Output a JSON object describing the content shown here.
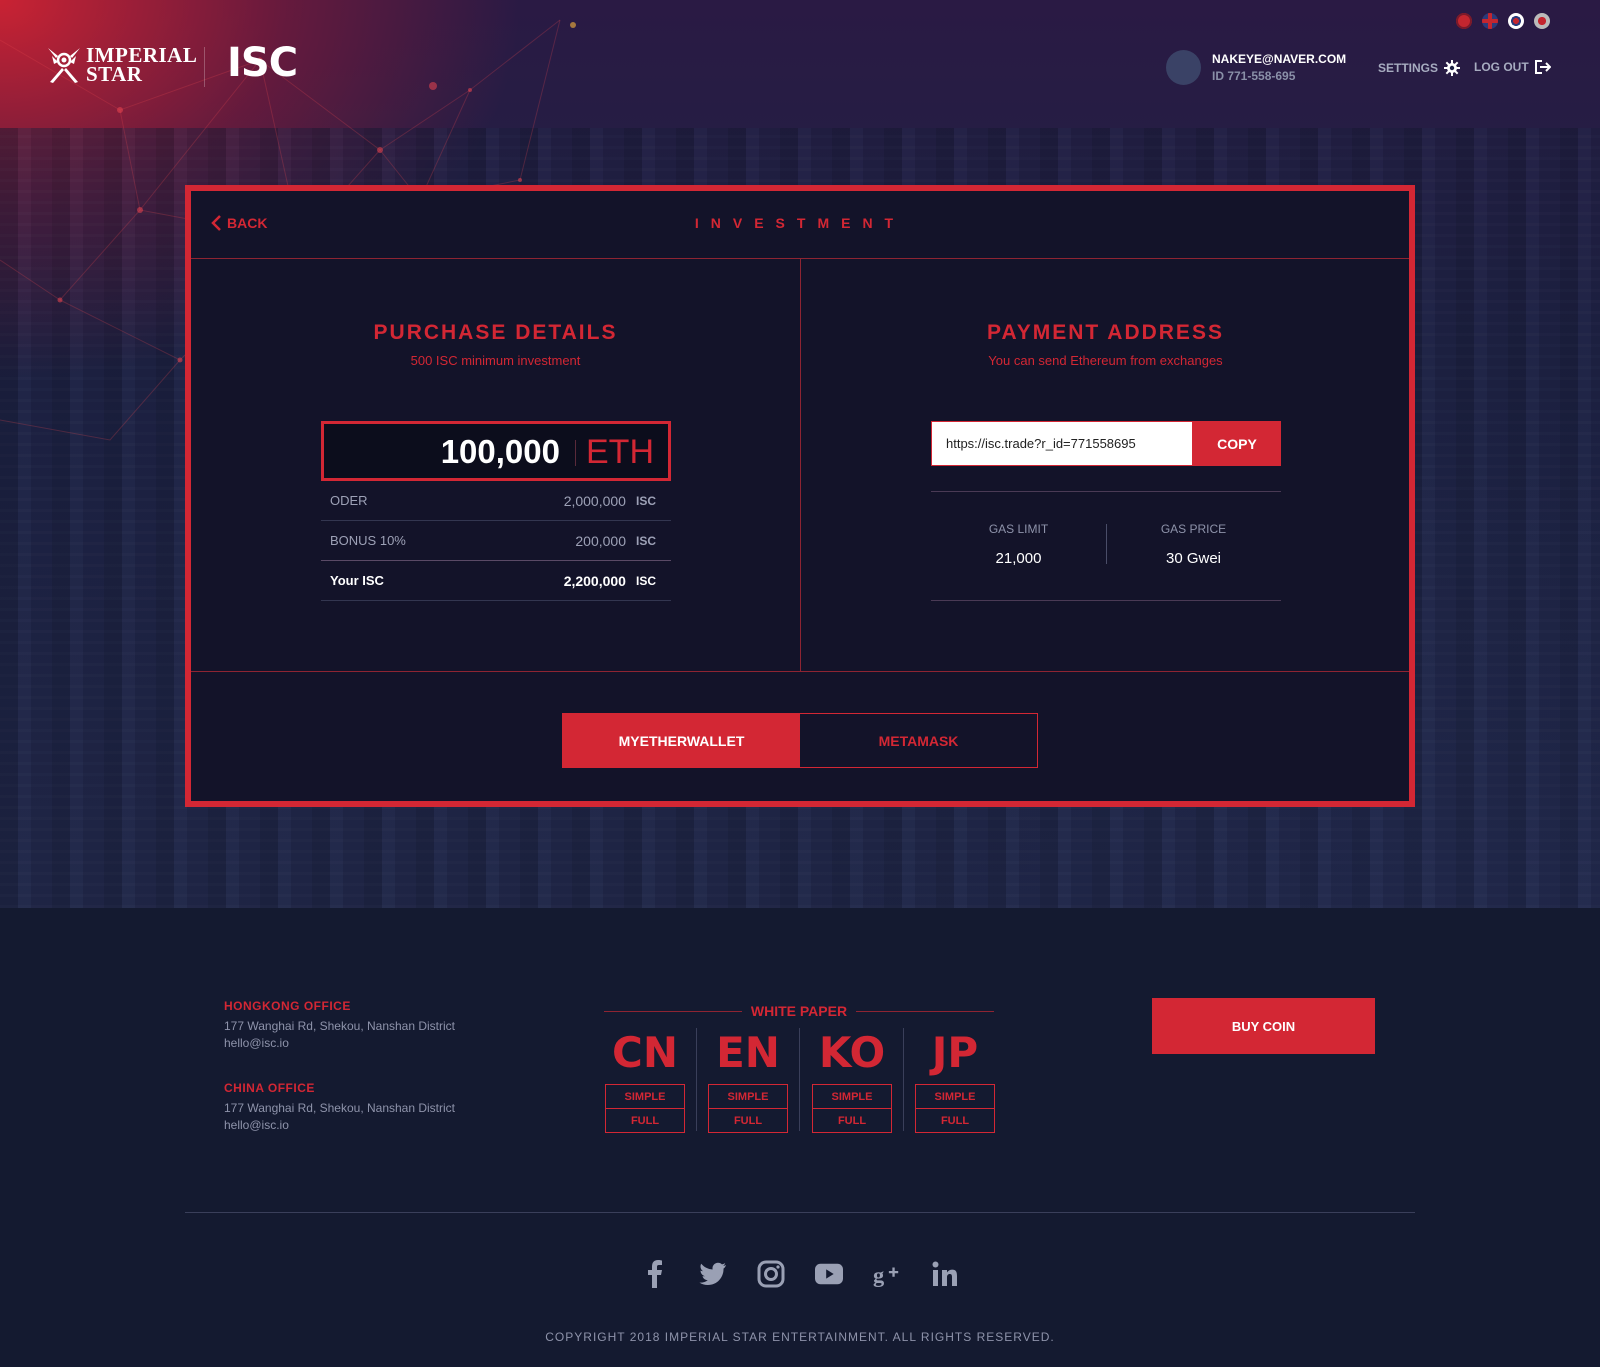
{
  "header": {
    "logo_line1": "IMPERIAL",
    "logo_line2": "STAR",
    "brand": "ISC",
    "user_email": "NAKEYE@NAVER.COM",
    "user_id": "ID 771-558-695",
    "settings_label": "SETTINGS",
    "logout_label": "LOG OUT",
    "flags": [
      "cn-flag",
      "uk-flag",
      "kr-flag",
      "jp-flag"
    ]
  },
  "card": {
    "back_label": "BACK",
    "title": "INVESTMENT",
    "purchase": {
      "title": "PURCHASE DETAILS",
      "subtitle": "500 ISC minimum investment",
      "amount": "100,000",
      "amount_unit": "ETH",
      "rows": [
        {
          "label": "ODER",
          "value": "2,000,000",
          "unit": "ISC"
        },
        {
          "label": "BONUS 10%",
          "value": "200,000",
          "unit": "ISC"
        },
        {
          "label": "Your ISC",
          "value": "2,200,000",
          "unit": "ISC"
        }
      ]
    },
    "payment": {
      "title": "PAYMENT ADDRESS",
      "subtitle": "You can send Ethereum from exchanges",
      "address": "https://isc.trade?r_id=771558695",
      "copy_label": "COPY",
      "gas_limit_label": "GAS LIMIT",
      "gas_limit_value": "21,000",
      "gas_price_label": "GAS PRICE",
      "gas_price_value": "30 Gwei"
    },
    "wallets": [
      "MYETHERWALLET",
      "METAMASK"
    ]
  },
  "footer": {
    "offices": [
      {
        "name": "HONGKONG OFFICE",
        "address": "177 Wanghai Rd, Shekou, Nanshan District",
        "email": "hello@isc.io"
      },
      {
        "name": "CHINA OFFICE",
        "address": "177 Wanghai Rd, Shekou, Nanshan District",
        "email": "hello@isc.io"
      }
    ],
    "white_paper_title": "WHITE PAPER",
    "white_paper": [
      {
        "code": "CN",
        "simple": "SIMPLE",
        "full": "FULL"
      },
      {
        "code": "EN",
        "simple": "SIMPLE",
        "full": "FULL"
      },
      {
        "code": "KO",
        "simple": "SIMPLE",
        "full": "FULL"
      },
      {
        "code": "JP",
        "simple": "SIMPLE",
        "full": "FULL"
      }
    ],
    "buy_label": "BUY COIN",
    "social": [
      "facebook-icon",
      "twitter-icon",
      "instagram-icon",
      "youtube-icon",
      "google-plus-icon",
      "linkedin-icon"
    ],
    "copyright": "COPYRIGHT 2018 IMPERIAL STAR ENTERTAINMENT. ALL RIGHTS RESERVED."
  },
  "colors": {
    "accent": "#d32734",
    "background": "#141a30",
    "card": "#131329"
  }
}
